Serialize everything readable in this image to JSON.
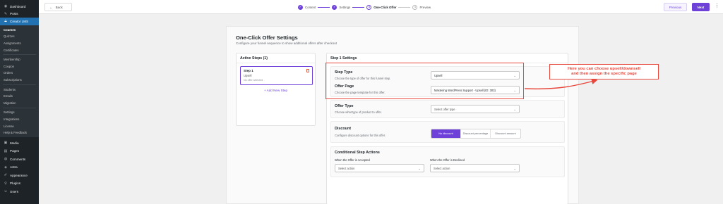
{
  "sidebar": {
    "items_top": [
      {
        "label": "Dashboard",
        "icon": "dashboard-icon",
        "glyph": "◉"
      },
      {
        "label": "Posts",
        "icon": "pin-icon",
        "glyph": "✎"
      }
    ],
    "active": {
      "label": "Creator LMS",
      "icon": "lms-icon",
      "glyph": "⟁"
    },
    "submenu_groups": [
      [
        "Courses",
        "Quizzes",
        "Assignments",
        "Certificates"
      ],
      [
        "Membership",
        "Coupon",
        "Orders",
        "Subscriptions"
      ],
      [
        "Students",
        "Emails",
        "Migration"
      ],
      [
        "Settings",
        "Integrations",
        "License",
        "Help & Feedback"
      ]
    ],
    "current_sub": "Courses",
    "items_bottom": [
      {
        "label": "Media",
        "icon": "media-icon",
        "glyph": "▣"
      },
      {
        "label": "Pages",
        "icon": "pages-icon",
        "glyph": "▤"
      },
      {
        "label": "Comments",
        "icon": "comment-icon",
        "glyph": "◍"
      },
      {
        "label": "Astra",
        "icon": "astra-icon",
        "glyph": "◈"
      },
      {
        "label": "Appearance",
        "icon": "brush-icon",
        "glyph": "✐"
      },
      {
        "label": "Plugins",
        "icon": "plugin-icon",
        "glyph": "⚲"
      },
      {
        "label": "Users",
        "icon": "users-icon",
        "glyph": "☺"
      }
    ]
  },
  "topbar": {
    "back_label": "Back",
    "steps": [
      {
        "label": "Content",
        "state": "done",
        "marker": "✓"
      },
      {
        "label": "Settings",
        "state": "done",
        "marker": "✓"
      },
      {
        "label": "One-Click Offer",
        "state": "current",
        "marker": "3"
      },
      {
        "label": "Preview",
        "state": "pending",
        "marker": "4"
      }
    ],
    "previous_label": "Previous",
    "next_label": "Next",
    "more_glyph": "⋮"
  },
  "page": {
    "title": "One-Click Offer Settings",
    "subtitle": "Configure your funnel sequence to show additional offers after checkout"
  },
  "active_steps": {
    "title": "Active Steps (1)",
    "step": {
      "name": "Step 1",
      "type": "Upsell",
      "offer": "No offer selected"
    },
    "add_label": "+ Add New Step"
  },
  "step_settings": {
    "title": "Step 1 Settings",
    "step_type": {
      "label": "Step Type",
      "desc": "Choose the type of offer for this funnel step.",
      "value": "Upsell"
    },
    "offer_page": {
      "label": "Offer Page",
      "desc": "Choose the page template for this offer.",
      "value": "Mastering WordPress Support - Upsell (ID: 303)"
    },
    "offer_type": {
      "label": "Offer Type",
      "desc": "Choose what type of product to offer.",
      "placeholder": "Select offer type"
    },
    "discount": {
      "label": "Discount",
      "desc": "Configure discount options for this offer.",
      "options": [
        "No discount",
        "Discount percentage",
        "Discount amount"
      ],
      "selected": "No discount"
    },
    "conditional": {
      "label": "Conditional Step Actions",
      "accepted_label": "When the Offer is Accepted",
      "accepted_placeholder": "Select action",
      "declined_label": "When the Offer is Declined",
      "declined_placeholder": "Select action"
    }
  },
  "annotation": {
    "line1": "Here you can choose upsell/downsell",
    "line2": "and then assign the specific page",
    "color": "#e8473c"
  },
  "colors": {
    "accent": "#6e41d8",
    "wp_sidebar": "#1d2327",
    "wp_active": "#2271b1"
  }
}
